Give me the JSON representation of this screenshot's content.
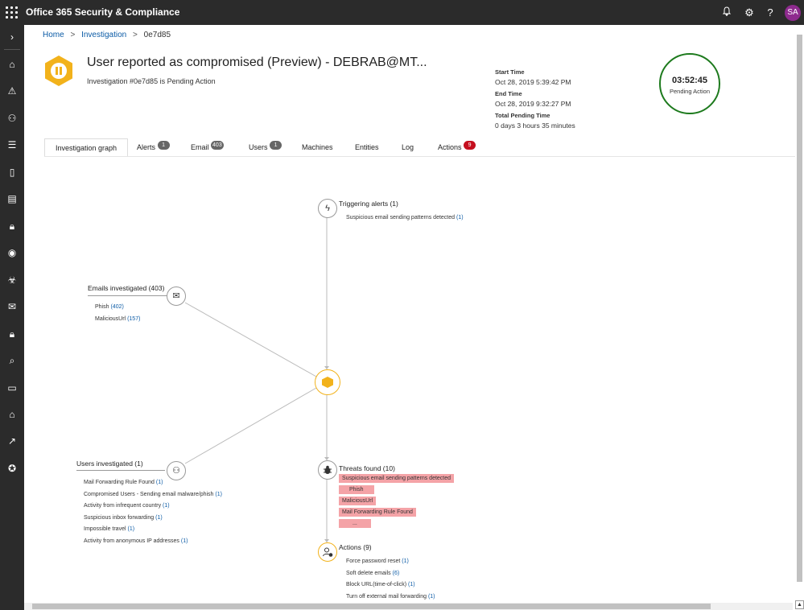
{
  "topbar": {
    "title": "Office 365 Security & Compliance",
    "icons": [
      "bell-icon",
      "gear-icon",
      "help-icon"
    ],
    "avatar": "SA"
  },
  "breadcrumb": [
    "Home",
    "Investigation",
    "0e7d85"
  ],
  "investigation": {
    "title": "User reported as compromised (Preview) - DEBRAB@MT...",
    "subtitle": "Investigation #0e7d85 is Pending Action",
    "start_label": "Start Time",
    "start_value": "Oct 28, 2019 5:39:42 PM",
    "end_label": "End Time",
    "end_value": "Oct 28, 2019 9:32:27 PM",
    "pending_label": "Total Pending Time",
    "pending_value": "0 days 3 hours 35 minutes",
    "timer": "03:52:45",
    "timer_status": "Pending Action"
  },
  "tabs": [
    {
      "label": "Investigation graph",
      "badge": ""
    },
    {
      "label": "Alerts",
      "badge": "1"
    },
    {
      "label": "Email",
      "badge": "403"
    },
    {
      "label": "Users",
      "badge": "1"
    },
    {
      "label": "Machines",
      "badge": ""
    },
    {
      "label": "Entities",
      "badge": ""
    },
    {
      "label": "Log",
      "badge": ""
    },
    {
      "label": "Actions",
      "badge": "9"
    }
  ],
  "graph": {
    "triggering": {
      "label": "Triggering alerts (1)",
      "items": [
        {
          "text": "Suspicious email sending patterns detected",
          "count": "(1)"
        }
      ]
    },
    "emails": {
      "label": "Emails investigated (403)",
      "items": [
        {
          "text": "Phish",
          "count": "(402)"
        },
        {
          "text": "MaliciousUrl",
          "count": "(157)"
        }
      ]
    },
    "users": {
      "label": "Users investigated (1)",
      "items": [
        {
          "text": "Mail Forwarding Rule Found",
          "count": "(1)"
        },
        {
          "text": "Compromised Users - Sending email malware/phish",
          "count": "(1)"
        },
        {
          "text": "Activity from infrequent country",
          "count": "(1)"
        },
        {
          "text": "Suspicious inbox forwarding",
          "count": "(1)"
        },
        {
          "text": "Impossible travel",
          "count": "(1)"
        },
        {
          "text": "Activity from anonymous IP addresses",
          "count": "(1)"
        }
      ]
    },
    "threats": {
      "label": "Threats found (10)",
      "items": [
        "Suspicious email sending patterns detected",
        "Phish",
        "MaliciousUrl",
        "Mail Forwarding Rule Found",
        "..."
      ]
    },
    "actions": {
      "label": "Actions (9)",
      "items": [
        {
          "text": "Force password reset",
          "count": "(1)"
        },
        {
          "text": "Soft delete emails",
          "count": "(6)"
        },
        {
          "text": "Block URL(time-of-click)",
          "count": "(1)"
        },
        {
          "text": "Turn off external mail forwarding",
          "count": "(1)"
        }
      ]
    }
  },
  "colors": {
    "accent": "#f2b21b",
    "link": "#0b5ba6",
    "threat": "#f4a3a7",
    "timer_ring": "#1d7a1d"
  }
}
